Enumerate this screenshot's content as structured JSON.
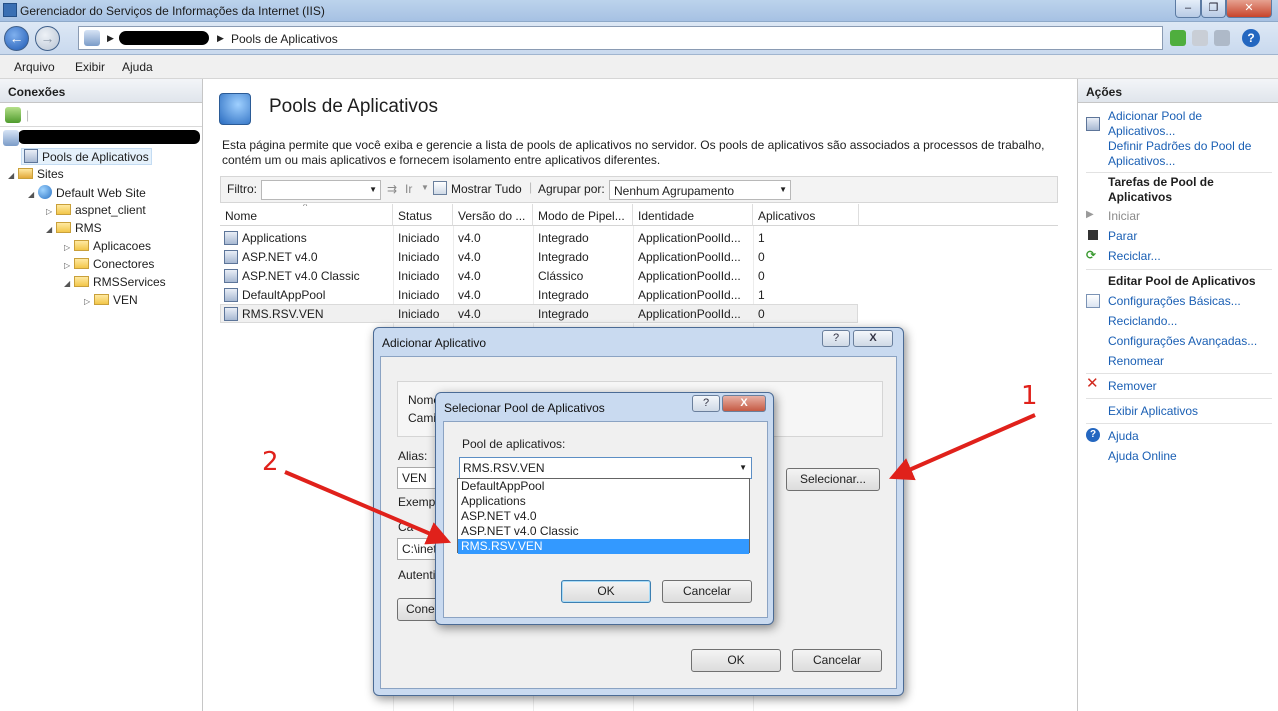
{
  "window": {
    "title": "Gerenciador do Serviços de Informações da Internet (IIS)"
  },
  "address": {
    "crumb": "Pools de Aplicativos"
  },
  "menu": {
    "items": [
      "Arquivo",
      "Exibir",
      "Ajuda"
    ]
  },
  "connections": {
    "header": "Conexões",
    "tree": [
      "Pools de Aplicativos",
      "Sites",
      "Default Web Site",
      "aspnet_client",
      "RMS",
      "Aplicacoes",
      "Conectores",
      "RMSServices",
      "VEN"
    ]
  },
  "main": {
    "title": "Pools de Aplicativos",
    "description": "Esta página permite que você exiba e gerencie a lista de pools de aplicativos no servidor. Os pools de aplicativos são associados a processos de trabalho, contém um ou mais aplicativos e fornecem isolamento entre aplicativos diferentes.",
    "filter_label": "Filtro:",
    "go_label": "Ir",
    "show_all_label": "Mostrar Tudo",
    "group_by_label": "Agrupar por:",
    "group_by_value": "Nenhum Agrupamento",
    "columns": [
      "Nome",
      "Status",
      "Versão do ...",
      "Modo de Pipel...",
      "Identidade",
      "Aplicativos"
    ],
    "rows": [
      [
        "Applications",
        "Iniciado",
        "v4.0",
        "Integrado",
        "ApplicationPoolId...",
        "1"
      ],
      [
        "ASP.NET v4.0",
        "Iniciado",
        "v4.0",
        "Integrado",
        "ApplicationPoolId...",
        "0"
      ],
      [
        "ASP.NET v4.0 Classic",
        "Iniciado",
        "v4.0",
        "Clássico",
        "ApplicationPoolId...",
        "0"
      ],
      [
        "DefaultAppPool",
        "Iniciado",
        "v4.0",
        "Integrado",
        "ApplicationPoolId...",
        "1"
      ],
      [
        "RMS.RSV.VEN",
        "Iniciado",
        "v4.0",
        "Integrado",
        "ApplicationPoolId...",
        "0"
      ]
    ]
  },
  "actions": {
    "header": "Ações",
    "add_pool": "Adicionar Pool de Aplicativos...",
    "set_defaults": "Definir Padrões do Pool de Aplicativos...",
    "tasks_head": "Tarefas de Pool de Aplicativos",
    "start": "Iniciar",
    "stop": "Parar",
    "recycle": "Reciclar...",
    "edit_head": "Editar Pool de Aplicativos",
    "basic": "Configurações Básicas...",
    "recycling": "Reciclando...",
    "advanced": "Configurações Avançadas...",
    "rename": "Renomear",
    "remove": "Remover",
    "view_apps": "Exibir Aplicativos",
    "help": "Ajuda",
    "online_help": "Ajuda Online"
  },
  "add_app_dialog": {
    "title": "Adicionar Aplicativo",
    "name_label": "Nome",
    "path_label": "Cami",
    "alias_label": "Alias:",
    "alias_value": "VEN",
    "example_label": "Exempl",
    "phys_label": "Ca",
    "phys_value": "C:\\inet",
    "auth_label": "Autenti",
    "connect_label": "Conec",
    "select_button": "Selecionar...",
    "ok": "OK",
    "cancel": "Cancelar",
    "help_glyph": "?",
    "close_glyph": "X"
  },
  "select_pool_dialog": {
    "title": "Selecionar Pool de Aplicativos",
    "pool_label": "Pool de aplicativos:",
    "selected": "RMS.RSV.VEN",
    "options": [
      "DefaultAppPool",
      "Applications",
      "ASP.NET v4.0",
      "ASP.NET v4.0 Classic",
      "RMS.RSV.VEN"
    ],
    "ok": "OK",
    "cancel": "Cancelar",
    "help_glyph": "?",
    "close_glyph": "X"
  },
  "annotations": {
    "one": "1",
    "two": "2"
  },
  "colors": {
    "accent": "#1a5fb4",
    "selection": "#3399ff",
    "arrow": "#e0211b"
  }
}
